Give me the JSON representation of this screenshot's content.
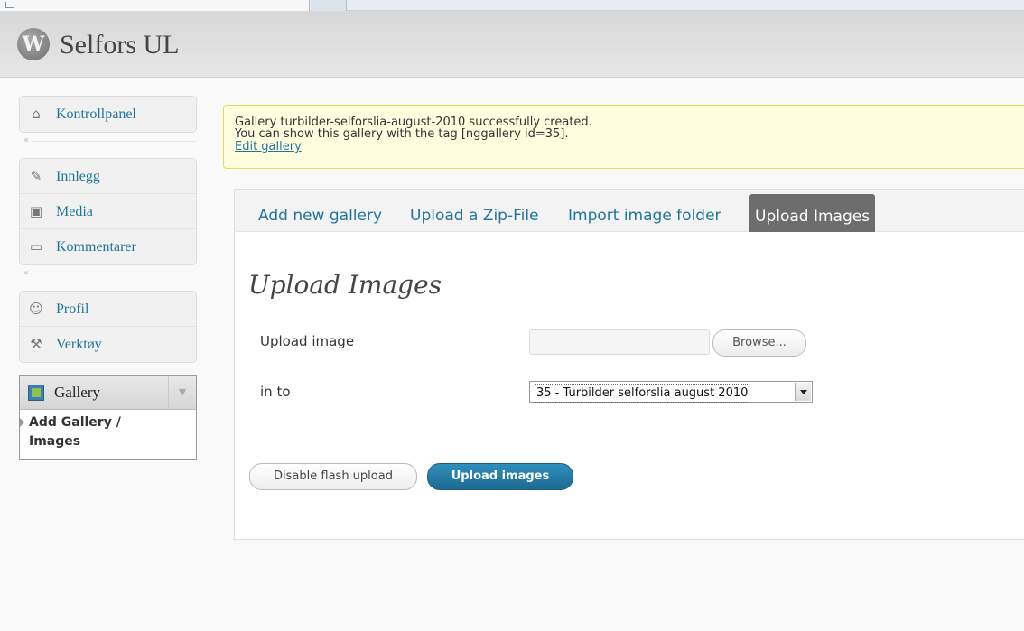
{
  "header": {
    "logo_letter": "W",
    "site_title": "Selfors UL"
  },
  "sidebar": {
    "groups": [
      {
        "items": [
          {
            "label": "Kontrollpanel",
            "icon": "home-icon"
          }
        ]
      },
      {
        "items": [
          {
            "label": "Innlegg",
            "icon": "pin-icon"
          },
          {
            "label": "Media",
            "icon": "media-icon"
          },
          {
            "label": "Kommentarer",
            "icon": "comment-icon"
          }
        ]
      },
      {
        "items": [
          {
            "label": "Profil",
            "icon": "users-icon"
          },
          {
            "label": "Verktøy",
            "icon": "tools-icon"
          }
        ]
      }
    ],
    "gallery": {
      "label": "Gallery",
      "icon": "gallery-icon",
      "submenu_line1": "Add Gallery /",
      "submenu_line2": "Images"
    }
  },
  "notice": {
    "line1": "Gallery turbilder-selforslia-august-2010 successfully created.",
    "line2": "You can show this gallery with the tag [nggallery id=35].",
    "link": "Edit gallery"
  },
  "tabs": [
    {
      "label": "Add new gallery",
      "active": false
    },
    {
      "label": "Upload a Zip-File",
      "active": false
    },
    {
      "label": "Import image folder",
      "active": false
    },
    {
      "label": "Upload Images",
      "active": true
    }
  ],
  "form": {
    "title": "Upload Images",
    "upload_label": "Upload image",
    "browse_label": "Browse...",
    "into_label": "in to",
    "gallery_selected": "35 - Turbilder selforslia august 2010",
    "disable_flash_label": "Disable flash upload",
    "upload_button_label": "Upload images"
  },
  "colors": {
    "link": "#21759b",
    "notice_bg": "#ffffe0",
    "notice_border": "#e6db55",
    "active_tab_bg": "#6d6d6d",
    "primary_button": "#21759b"
  }
}
